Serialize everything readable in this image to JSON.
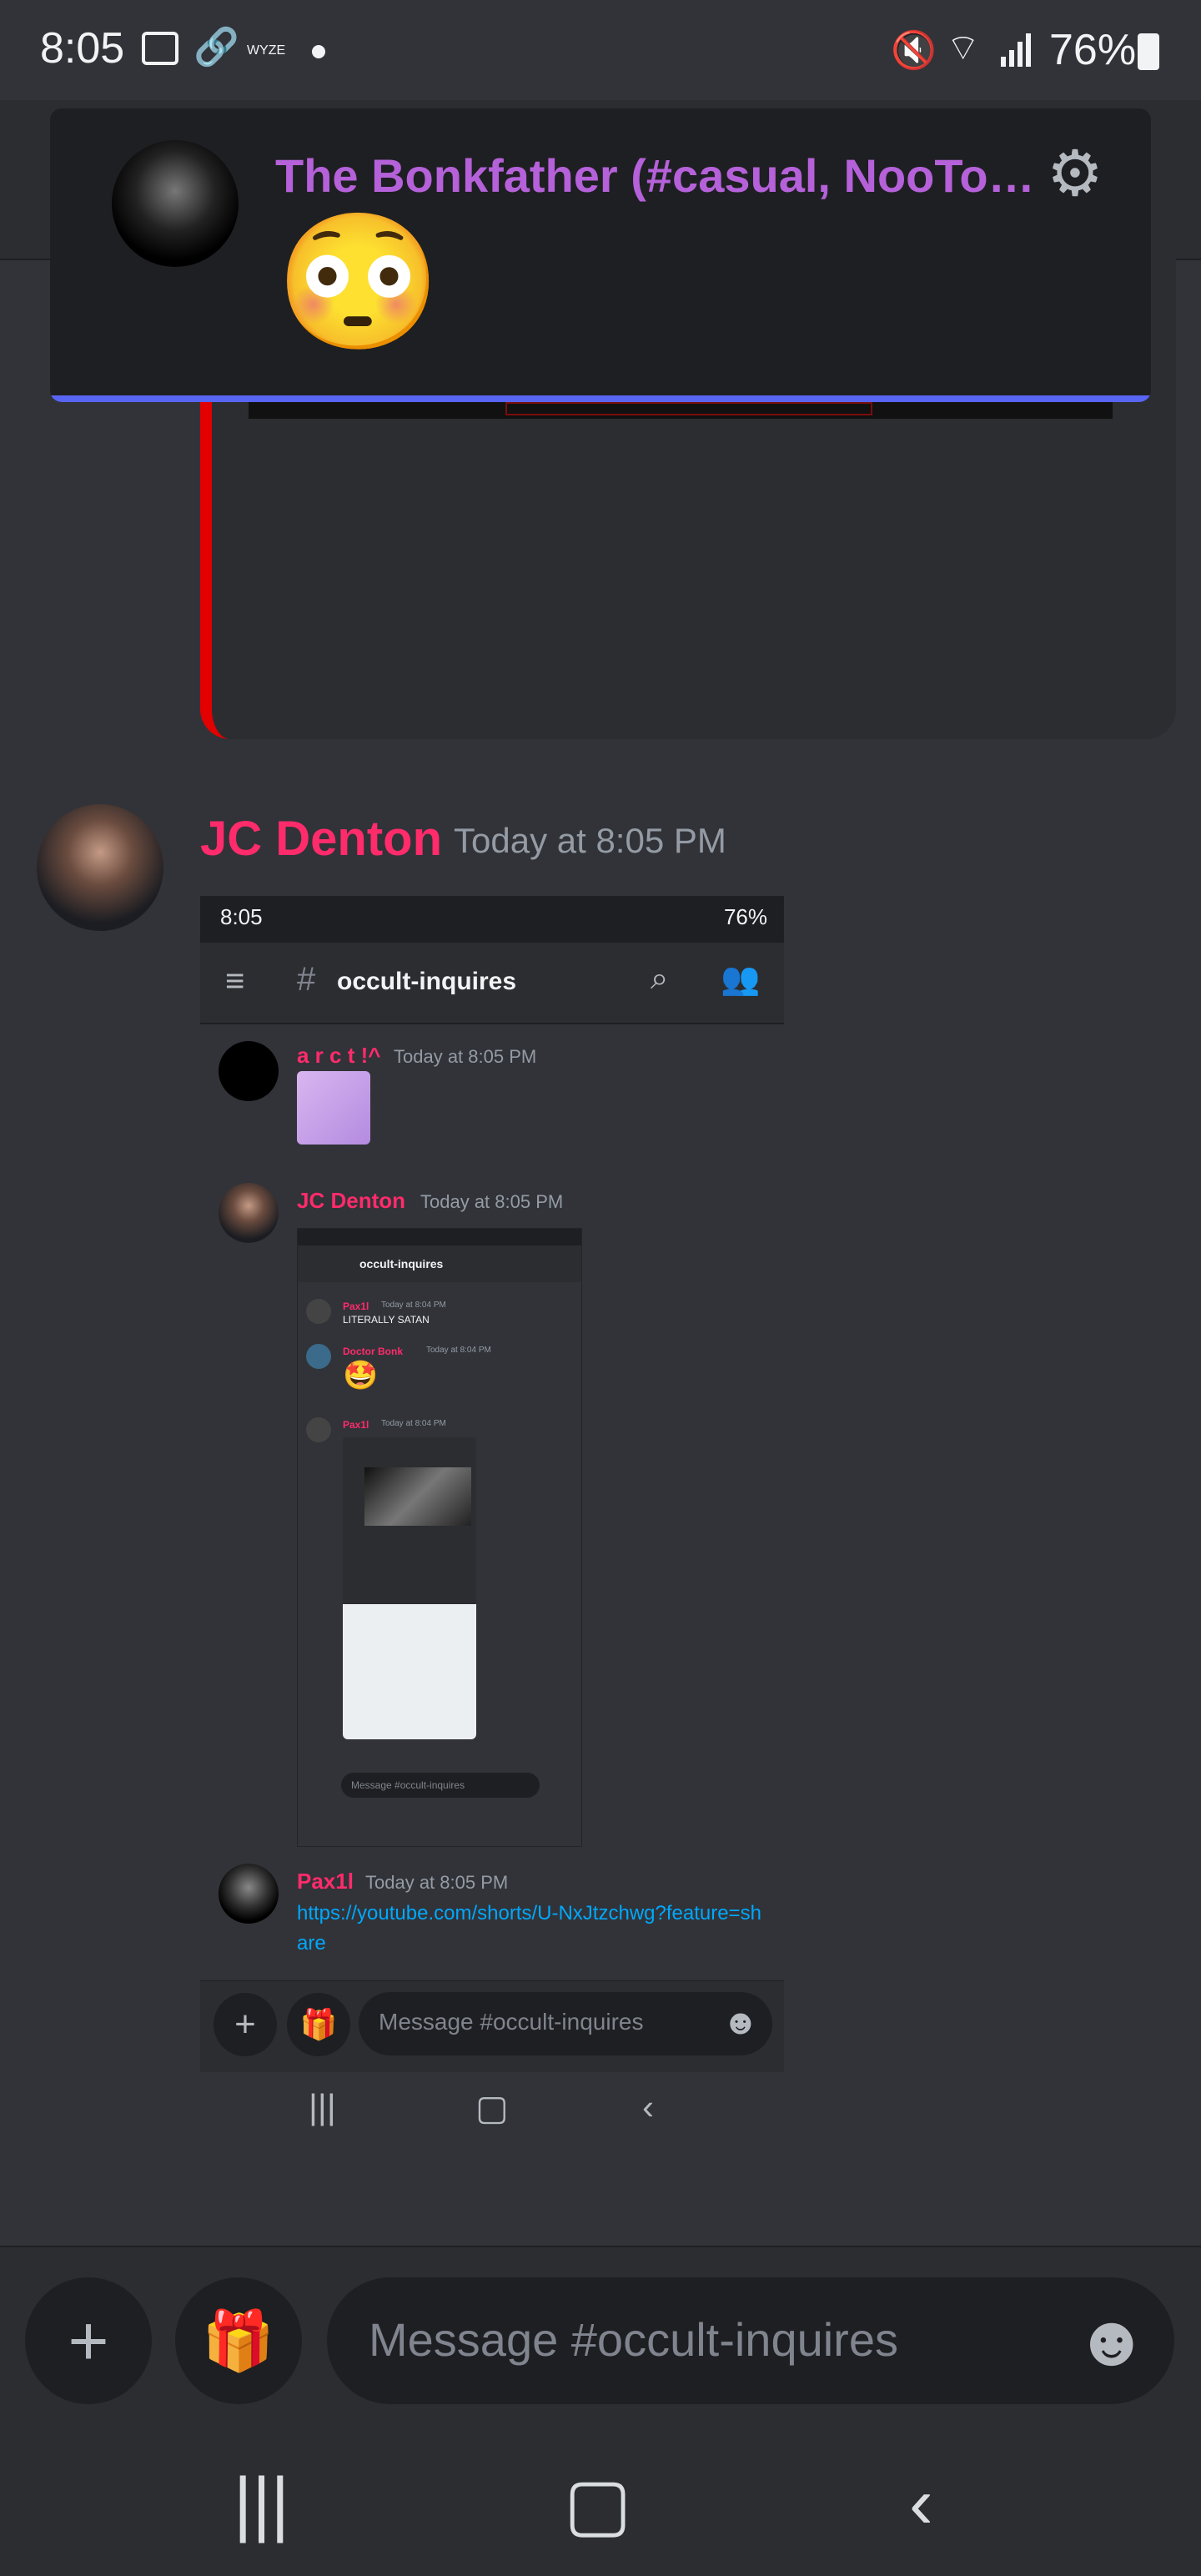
{
  "status_bar": {
    "time": "8:05",
    "wyze": "WYZE",
    "battery": "76%"
  },
  "notification": {
    "title": "The Bonkfather (#casual, NooTopi...",
    "emoji": "😳",
    "settings_icon": "gear-icon"
  },
  "message": {
    "author": "JC Denton",
    "timestamp": "Today at 8:05 PM"
  },
  "screenshot": {
    "status_time": "8:05",
    "status_battery": "76%",
    "channel": "occult-inquires",
    "messages": [
      {
        "author": "a r c t !^",
        "timestamp": "Today at 8:05 PM",
        "color": "#ff2b6b"
      },
      {
        "author": "JC Denton",
        "timestamp": "Today at 8:05 PM",
        "color": "#ff2b6b"
      },
      {
        "author": "Pax1l",
        "timestamp": "Today at 8:05 PM",
        "color": "#ff2b6b",
        "link": "https://youtube.com/shorts/U-NxJtzchwg?feature=share"
      }
    ],
    "inner": {
      "channel": "occult-inquires",
      "msg1_author": "Pax1l",
      "msg1_ts": "Today at 8:04 PM",
      "msg1_text": "LITERALLY SATAN",
      "msg2_author": "Doctor Bonk",
      "msg2_ts": "Today at 8:04 PM",
      "msg3_author": "Pax1l",
      "msg3_ts": "Today at 8:04 PM",
      "input_placeholder": "Message #occult-inquires"
    },
    "input_placeholder": "Message #occult-inquires"
  },
  "composer": {
    "placeholder": "Message #occult-inquires"
  },
  "colors": {
    "accent": "#5865f2",
    "username": "#ff2b6b",
    "notification_title": "#b561d9",
    "link": "#00a8fc",
    "embed_bar": "#e30000"
  }
}
